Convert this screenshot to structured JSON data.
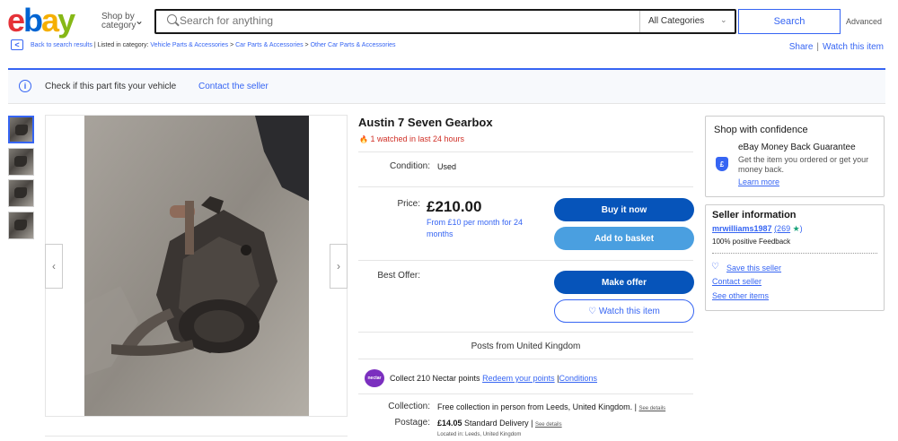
{
  "header": {
    "logo": {
      "e": "e",
      "b": "b",
      "a": "a",
      "y": "y"
    },
    "shop_by_category": [
      "Shop by",
      "category"
    ],
    "search_placeholder": "Search for anything",
    "category_select": "All Categories",
    "search_button": "Search",
    "advanced": "Advanced"
  },
  "breadcrumb": {
    "back": "Back to search results",
    "listed_in": "| Listed in category:",
    "items": [
      "Vehicle Parts & Accessories",
      "Car Parts & Accessories",
      "Other Car Parts & Accessories"
    ],
    "separator": ">",
    "share": "Share",
    "divider": "|",
    "watch": "Watch this item"
  },
  "fit_banner": {
    "text": "Check if this part fits your vehicle",
    "contact": "Contact the seller"
  },
  "listing": {
    "title": "Austin 7 Seven Gearbox",
    "watched": "1 watched in last 24 hours",
    "condition_label": "Condition:",
    "condition_value": "Used",
    "price_label": "Price:",
    "price": "£210.00",
    "finance": "From £10 per month for 24 months",
    "buy_now": "Buy it now",
    "add_to_basket": "Add to basket",
    "best_offer_label": "Best Offer:",
    "make_offer": "Make offer",
    "watch_item": "♡ Watch this item",
    "posts_from": "Posts from United Kingdom",
    "nectar": {
      "logo": "nectar",
      "prefix": "Collect 210 Nectar points",
      "redeem": "Redeem your points",
      "sep": "|",
      "conditions": "Conditions"
    },
    "collection_label": "Collection:",
    "collection_value": "Free collection in person from Leeds, United Kingdom. |",
    "postage_label": "Postage:",
    "postage_price": "£14.05",
    "postage_value": "Standard Delivery |",
    "see_details": "See details",
    "located_in": "Located in: Leeds, United Kingdom"
  },
  "confidence": {
    "title": "Shop with confidence",
    "guarantee_title": "eBay Money Back Guarantee",
    "guarantee_text": "Get the item you ordered or get your money back.",
    "learn_more": "Learn more",
    "shield_symbol": "£"
  },
  "seller": {
    "title": "Seller information",
    "name": "mrwilliams1987",
    "feedback_count": "(269",
    "star": "★",
    "close_paren": ")",
    "positive": "100% positive Feedback",
    "save_seller": "Save this seller",
    "contact": "Contact seller",
    "other_items": "See other items"
  },
  "icons": {
    "chevron_down": "⌄",
    "chevron_left": "‹",
    "chevron_right": "›",
    "back_arrow": "<",
    "info": "i",
    "fire": "🔥",
    "heart": "♡"
  },
  "colors": {
    "accent": "#3665f3",
    "primary_button": "#0654ba",
    "secondary_button": "#4a9fe0",
    "watched_red": "#d03027"
  }
}
